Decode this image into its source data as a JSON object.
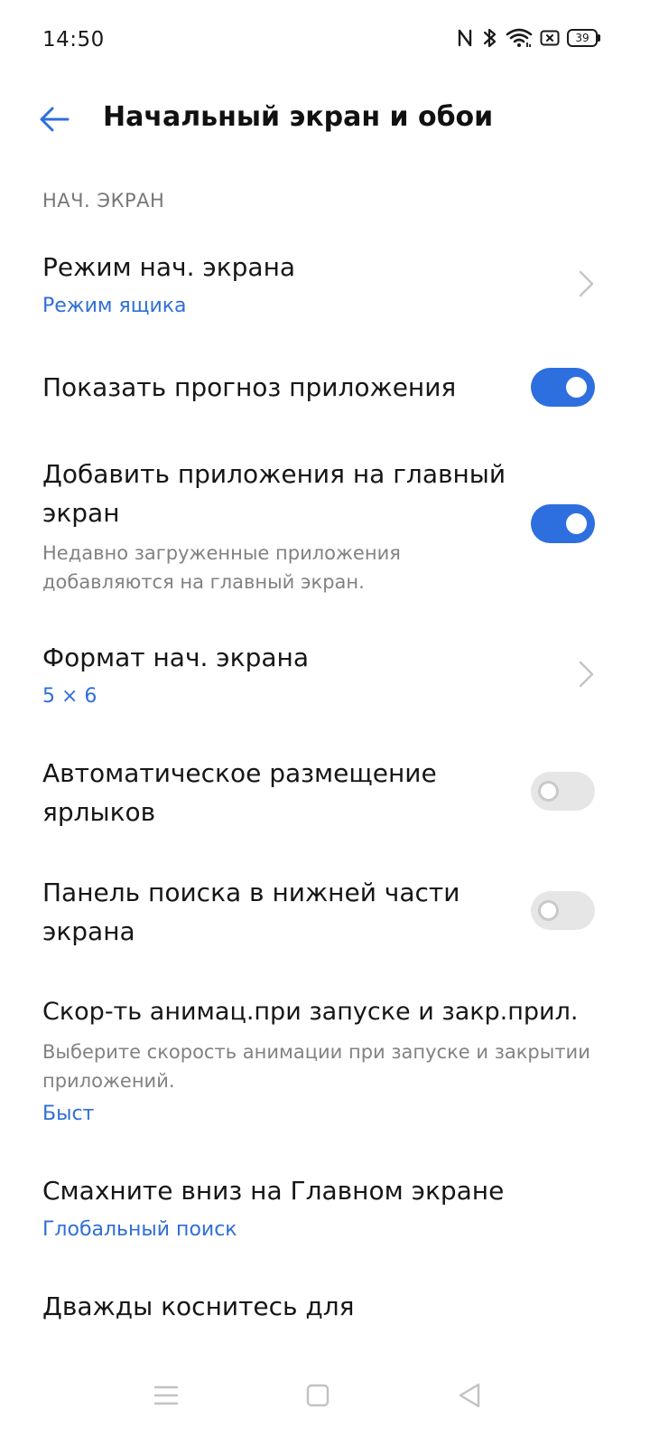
{
  "status_bar": {
    "time": "14:50",
    "battery": "39",
    "icons": [
      "nfc-icon",
      "bluetooth-icon",
      "wifi-icon",
      "sim-icon",
      "battery-icon"
    ]
  },
  "header": {
    "title": "Начальный экран и обои"
  },
  "section": {
    "title": "НАЧ. ЭКРАН"
  },
  "settings": {
    "home_mode": {
      "title": "Режим нач. экрана",
      "value": "Режим ящика"
    },
    "app_prediction": {
      "title": "Показать прогноз приложения",
      "enabled": true
    },
    "add_apps": {
      "title": "Добавить приложения на главный экран",
      "description": "Недавно загруженные приложения добавляются на главный экран.",
      "enabled": true
    },
    "home_format": {
      "title": "Формат нач. экрана",
      "value": "5 × 6"
    },
    "auto_arrange": {
      "title": "Автоматическое размещение ярлыков",
      "enabled": false
    },
    "search_bar": {
      "title": "Панель поиска в нижней части экрана",
      "enabled": false
    },
    "animation_speed": {
      "title": "Скор-ть анимац.при запуске и закр.прил.",
      "description": "Выберите скорость анимации при запуске и закрытии приложений.",
      "value": "Быст"
    },
    "swipe_down": {
      "title": "Смахните вниз на Главном экране",
      "value": "Глобальный поиск"
    },
    "double_tap": {
      "title": "Дважды коснитесь для"
    }
  },
  "colors": {
    "accent": "#2e6fe0",
    "link": "#2f6fd6",
    "toggle_off": "#e6e6e6"
  }
}
